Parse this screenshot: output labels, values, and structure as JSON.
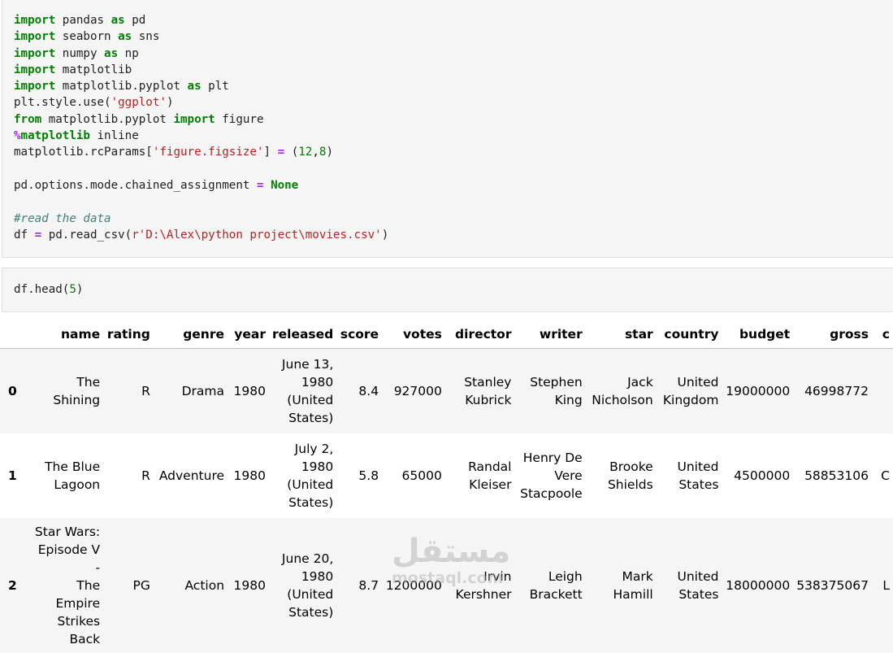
{
  "code_cell_1": {
    "lines": [
      [
        {
          "t": "import",
          "c": "kw"
        },
        {
          "t": " pandas "
        },
        {
          "t": "as",
          "c": "kw"
        },
        {
          "t": " pd"
        }
      ],
      [
        {
          "t": "import",
          "c": "kw"
        },
        {
          "t": " seaborn "
        },
        {
          "t": "as",
          "c": "kw"
        },
        {
          "t": " sns"
        }
      ],
      [
        {
          "t": "import",
          "c": "kw"
        },
        {
          "t": " numpy "
        },
        {
          "t": "as",
          "c": "kw"
        },
        {
          "t": " np"
        }
      ],
      [
        {
          "t": "import",
          "c": "kw"
        },
        {
          "t": " matplotlib"
        }
      ],
      [
        {
          "t": "import",
          "c": "kw"
        },
        {
          "t": " matplotlib.pyplot "
        },
        {
          "t": "as",
          "c": "kw"
        },
        {
          "t": " plt"
        }
      ],
      [
        {
          "t": "plt.style.use("
        },
        {
          "t": "'ggplot'",
          "c": "str"
        },
        {
          "t": ")"
        }
      ],
      [
        {
          "t": "from",
          "c": "kw"
        },
        {
          "t": " matplotlib.pyplot "
        },
        {
          "t": "import",
          "c": "kw"
        },
        {
          "t": " figure"
        }
      ],
      [
        {
          "t": "%",
          "c": "op"
        },
        {
          "t": "matplotlib",
          "c": "kw"
        },
        {
          "t": " inline"
        }
      ],
      [
        {
          "t": "matplotlib.rcParams["
        },
        {
          "t": "'figure.figsize'",
          "c": "str"
        },
        {
          "t": "] "
        },
        {
          "t": "=",
          "c": "op"
        },
        {
          "t": " ("
        },
        {
          "t": "12",
          "c": "num"
        },
        {
          "t": ","
        },
        {
          "t": "8",
          "c": "num"
        },
        {
          "t": ")"
        }
      ],
      [],
      [
        {
          "t": "pd.options.mode.chained_assignment "
        },
        {
          "t": "=",
          "c": "op"
        },
        {
          "t": " "
        },
        {
          "t": "None",
          "c": "kw"
        }
      ],
      [],
      [
        {
          "t": "#read the data",
          "c": "cm"
        }
      ],
      [
        {
          "t": "df "
        },
        {
          "t": "=",
          "c": "op"
        },
        {
          "t": " pd.read_csv("
        },
        {
          "t": "r'D:\\Alex\\python project\\movies.csv'",
          "c": "str"
        },
        {
          "t": ")"
        }
      ]
    ]
  },
  "code_cell_2": {
    "lines": [
      [
        {
          "t": "df.head("
        },
        {
          "t": "5",
          "c": "num"
        },
        {
          "t": ")"
        }
      ]
    ]
  },
  "dataframe": {
    "columns": [
      "name",
      "rating",
      "genre",
      "year",
      "released",
      "score",
      "votes",
      "director",
      "writer",
      "star",
      "country",
      "budget",
      "gross",
      "c"
    ],
    "rows": [
      {
        "index": "0",
        "cells": [
          [
            "The Shining"
          ],
          [
            "R"
          ],
          [
            "Drama"
          ],
          [
            "1980"
          ],
          [
            "June 13,",
            "1980",
            "(United",
            "States)"
          ],
          [
            "8.4"
          ],
          [
            "927000"
          ],
          [
            "Stanley",
            "Kubrick"
          ],
          [
            "Stephen",
            "King"
          ],
          [
            "Jack",
            "Nicholson"
          ],
          [
            "United",
            "Kingdom"
          ],
          [
            "19000000"
          ],
          [
            "46998772"
          ],
          [
            ""
          ]
        ]
      },
      {
        "index": "1",
        "cells": [
          [
            "The Blue",
            "Lagoon"
          ],
          [
            "R"
          ],
          [
            "Adventure"
          ],
          [
            "1980"
          ],
          [
            "July 2,",
            "1980",
            "(United",
            "States)"
          ],
          [
            "5.8"
          ],
          [
            "65000"
          ],
          [
            "Randal",
            "Kleiser"
          ],
          [
            "Henry De",
            "Vere",
            "Stacpoole"
          ],
          [
            "Brooke",
            "Shields"
          ],
          [
            "United",
            "States"
          ],
          [
            "4500000"
          ],
          [
            "58853106"
          ],
          [
            "C"
          ]
        ]
      },
      {
        "index": "2",
        "cells": [
          [
            "Star Wars:",
            "Episode V -",
            "The Empire",
            "Strikes Back"
          ],
          [
            "PG"
          ],
          [
            "Action"
          ],
          [
            "1980"
          ],
          [
            "June 20,",
            "1980",
            "(United",
            "States)"
          ],
          [
            "8.7"
          ],
          [
            "1200000"
          ],
          [
            "Irvin",
            "Kershner"
          ],
          [
            "Leigh",
            "Brackett"
          ],
          [
            "Mark",
            "Hamill"
          ],
          [
            "United",
            "States"
          ],
          [
            "18000000"
          ],
          [
            "538375067"
          ],
          [
            "L"
          ]
        ]
      }
    ]
  },
  "watermark": {
    "logo": "مستقل",
    "site": "mostaql.com"
  }
}
